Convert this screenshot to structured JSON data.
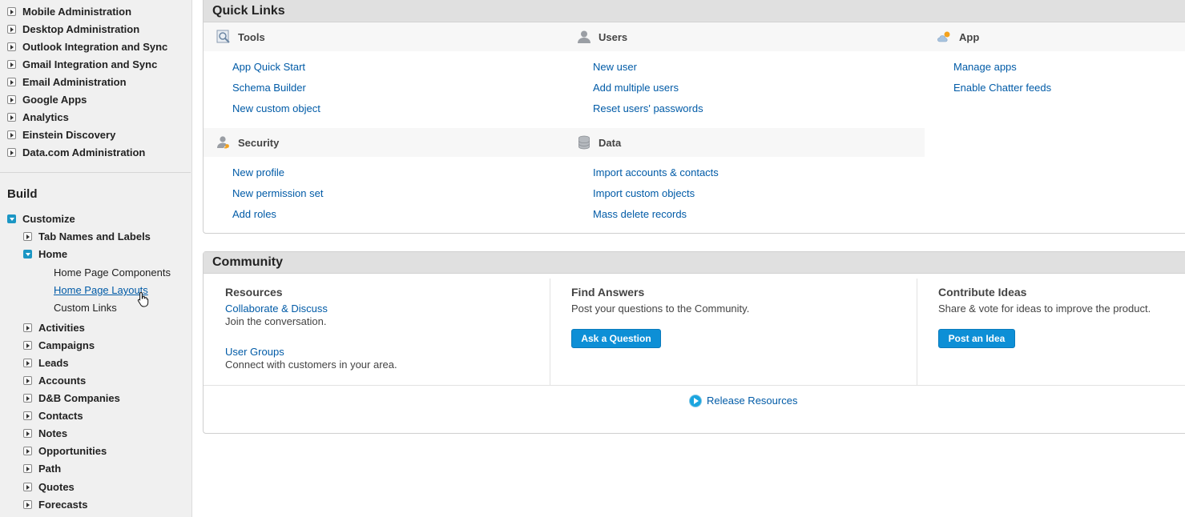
{
  "sidebar": {
    "admin_items": [
      "Mobile Administration",
      "Desktop Administration",
      "Outlook Integration and Sync",
      "Gmail Integration and Sync",
      "Email Administration",
      "Google Apps",
      "Analytics",
      "Einstein Discovery",
      "Data.com Administration"
    ],
    "build_heading": "Build",
    "customize": "Customize",
    "tab_names": "Tab Names and Labels",
    "home": "Home",
    "home_children": [
      "Home Page Components",
      "Home Page Layouts",
      "Custom Links"
    ],
    "build_items": [
      "Activities",
      "Campaigns",
      "Leads",
      "Accounts",
      "D&B Companies",
      "Contacts",
      "Notes",
      "Opportunities",
      "Path",
      "Quotes",
      "Forecasts"
    ]
  },
  "quick_links": {
    "title": "Quick Links",
    "tools": {
      "title": "Tools",
      "links": [
        "App Quick Start",
        "Schema Builder",
        "New custom object"
      ]
    },
    "users": {
      "title": "Users",
      "links": [
        "New user",
        "Add multiple users",
        "Reset users' passwords"
      ]
    },
    "app": {
      "title": "App",
      "links": [
        "Manage apps",
        "Enable Chatter feeds"
      ]
    },
    "security": {
      "title": "Security",
      "links": [
        "New profile",
        "New permission set",
        "Add roles"
      ]
    },
    "data": {
      "title": "Data",
      "links": [
        "Import accounts & contacts",
        "Import custom objects",
        "Mass delete records"
      ]
    }
  },
  "community": {
    "title": "Community",
    "resources": {
      "title": "Resources",
      "link1": "Collaborate & Discuss",
      "text1": "Join the conversation.",
      "link2": "User Groups",
      "text2": "Connect with customers in your area."
    },
    "answers": {
      "title": "Find Answers",
      "text": "Post your questions to the Community.",
      "button": "Ask a Question"
    },
    "ideas": {
      "title": "Contribute Ideas",
      "text": "Share & vote for ideas to improve the product.",
      "button": "Post an Idea"
    },
    "release": "Release Resources"
  },
  "colors": {
    "link": "#015ba7",
    "button": "#0d8fd6",
    "tree_open": "#1b96c4"
  }
}
